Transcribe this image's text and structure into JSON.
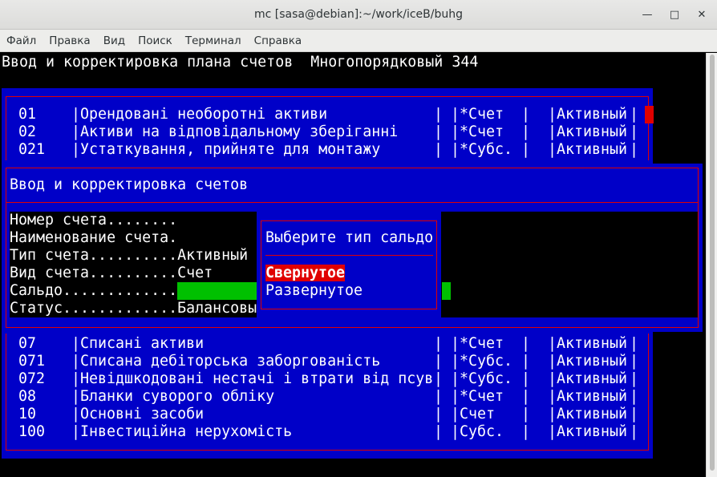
{
  "window": {
    "title": "mc [sasa@debian]:~/work/iceB/buhg",
    "minimize": "—",
    "maximize": "□",
    "close": "✕"
  },
  "menu": [
    "Файл",
    "Правка",
    "Вид",
    "Поиск",
    "Терминал",
    "Справка"
  ],
  "header": "Ввод и корректировка плана счетов  Многопорядковый 344",
  "top_rows": [
    {
      "code": "01",
      "name": "Орендовані необоротні активи",
      "kind": "*Счет",
      "type": "Активный"
    },
    {
      "code": "02",
      "name": "Активи на відповідальному зберіганні",
      "kind": "*Счет",
      "type": "Активный"
    },
    {
      "code": "021",
      "name": "Устаткування, прийняте для монтажу",
      "kind": "*Субс.",
      "type": "Активный"
    }
  ],
  "bottom_rows": [
    {
      "code": "07",
      "name": "Списані активи",
      "kind": "*Счет",
      "type": "Активный"
    },
    {
      "code": "071",
      "name": "Списана дебіторська заборгованість",
      "kind": "*Субс.",
      "type": "Активный"
    },
    {
      "code": "072",
      "name": "Невідшкодовані нестачі і втрати від псув",
      "kind": "*Субс.",
      "type": "Активный"
    },
    {
      "code": "08",
      "name": "Бланки суворого обліку",
      "kind": "*Счет",
      "type": "Активный"
    },
    {
      "code": "10",
      "name": "Основні засоби",
      "kind": "Счет",
      "type": "Активный"
    },
    {
      "code": "100",
      "name": "Інвестиційна нерухомість",
      "kind": "Субс.",
      "type": "Активный"
    }
  ],
  "edit_dialog": {
    "title": "Ввод и корректировка счетов",
    "fields": [
      {
        "label": "Номер счета........",
        "value": ""
      },
      {
        "label": "Наименование счета.",
        "value": ""
      },
      {
        "label": "Тип счета..........",
        "value": "Активный"
      },
      {
        "label": "Вид счета..........",
        "value": "Счет"
      },
      {
        "label": "Сальдо.............",
        "value": ""
      },
      {
        "label": "Статус.............",
        "value": "Балансовы"
      }
    ]
  },
  "saldo_menu": {
    "title": "Выберите тип сальдо",
    "options": [
      "Свернутое",
      "Развернутое"
    ],
    "selected": "Свернутое"
  }
}
